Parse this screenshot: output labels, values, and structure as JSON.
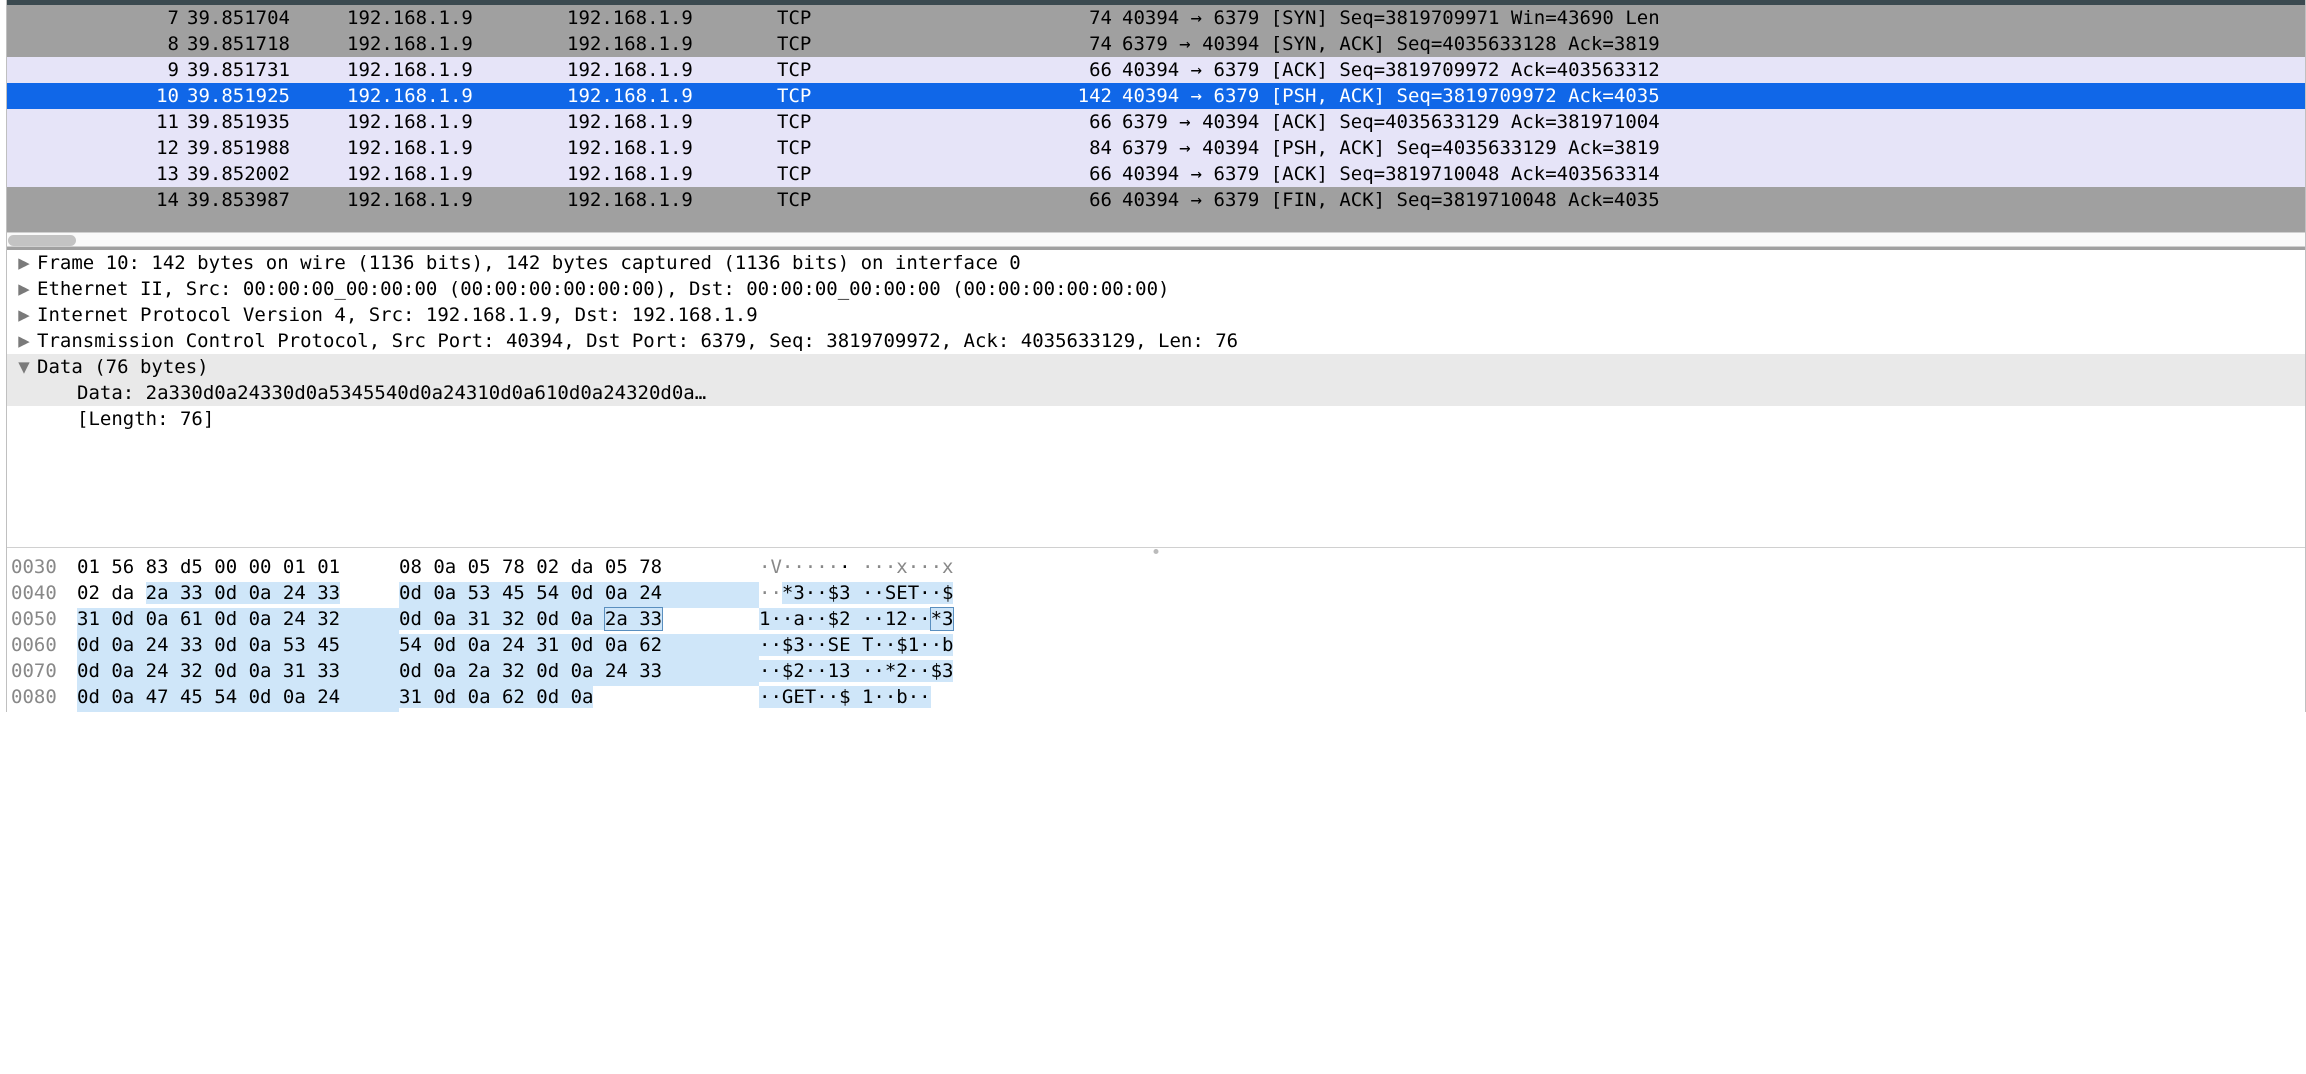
{
  "packets": [
    {
      "no": "7",
      "time": "39.851704",
      "src": "192.168.1.9",
      "dst": "192.168.1.9",
      "proto": "TCP",
      "len": "74",
      "info": "40394 → 6379 [SYN] Seq=3819709971 Win=43690 Len",
      "bg": "bg-gray"
    },
    {
      "no": "8",
      "time": "39.851718",
      "src": "192.168.1.9",
      "dst": "192.168.1.9",
      "proto": "TCP",
      "len": "74",
      "info": "6379 → 40394 [SYN, ACK] Seq=4035633128 Ack=3819",
      "bg": "bg-gray"
    },
    {
      "no": "9",
      "time": "39.851731",
      "src": "192.168.1.9",
      "dst": "192.168.1.9",
      "proto": "TCP",
      "len": "66",
      "info": "40394 → 6379 [ACK] Seq=3819709972 Ack=403563312",
      "bg": "bg-lav"
    },
    {
      "no": "10",
      "time": "39.851925",
      "src": "192.168.1.9",
      "dst": "192.168.1.9",
      "proto": "TCP",
      "len": "142",
      "info": "40394 → 6379 [PSH, ACK] Seq=3819709972 Ack=4035",
      "bg": "bg-sel"
    },
    {
      "no": "11",
      "time": "39.851935",
      "src": "192.168.1.9",
      "dst": "192.168.1.9",
      "proto": "TCP",
      "len": "66",
      "info": "6379 → 40394 [ACK] Seq=4035633129 Ack=381971004",
      "bg": "bg-lav"
    },
    {
      "no": "12",
      "time": "39.851988",
      "src": "192.168.1.9",
      "dst": "192.168.1.9",
      "proto": "TCP",
      "len": "84",
      "info": "6379 → 40394 [PSH, ACK] Seq=4035633129 Ack=3819",
      "bg": "bg-lav"
    },
    {
      "no": "13",
      "time": "39.852002",
      "src": "192.168.1.9",
      "dst": "192.168.1.9",
      "proto": "TCP",
      "len": "66",
      "info": "40394 → 6379 [ACK] Seq=3819710048 Ack=403563314",
      "bg": "bg-lav"
    },
    {
      "no": "14",
      "time": "39.853987",
      "src": "192.168.1.9",
      "dst": "192.168.1.9",
      "proto": "TCP",
      "len": "66",
      "info": "40394 → 6379 [FIN, ACK] Seq=3819710048 Ack=4035",
      "bg": "bg-gray"
    }
  ],
  "details": {
    "frame": "Frame 10: 142 bytes on wire (1136 bits), 142 bytes captured (1136 bits) on interface 0",
    "eth": "Ethernet II, Src: 00:00:00_00:00:00 (00:00:00:00:00:00), Dst: 00:00:00_00:00:00 (00:00:00:00:00:00)",
    "ip": "Internet Protocol Version 4, Src: 192.168.1.9, Dst: 192.168.1.9",
    "tcp": "Transmission Control Protocol, Src Port: 40394, Dst Port: 6379, Seq: 3819709972, Ack: 4035633129, Len: 76",
    "data_hdr": "Data (76 bytes)",
    "data_hex": "Data: 2a330d0a24330d0a5345540d0a24310d0a610d0a24320d0a…",
    "data_len": "[Length: 76]"
  },
  "hex": {
    "r0030": {
      "off": "0030",
      "c1": "01 56 83 d5 00 00 01 01",
      "c2": "08 0a 05 78 02 da 05 78",
      "a1a": "·V·····",
      "a1b": "·",
      "a2": " ···x···x"
    },
    "r0040": {
      "off": "0040",
      "c1a": "02 da ",
      "c1b": "2a 33 0d 0a 24 33",
      "c2": "0d 0a 53 45 54 0d 0a 24",
      "a1a": "··",
      "a1b": "*3··$3",
      "a2": " ··SET··$"
    },
    "r0050": {
      "off": "0050",
      "c1": "31 0d 0a 61 0d 0a 24 32",
      "c2a": "0d 0a 31 32 0d 0a ",
      "c2b": "2a 33",
      "a1": "1··a··$2",
      "a2a": " ··12··",
      "a2b": "*3"
    },
    "r0060": {
      "off": "0060",
      "c1": "0d 0a 24 33 0d 0a 53 45",
      "c2": "54 0d 0a 24 31 0d 0a 62",
      "a1": "··$3··SE",
      "a2": " T··$1··b"
    },
    "r0070": {
      "off": "0070",
      "c1": "0d 0a 24 32 0d 0a 31 33",
      "c2": "0d 0a 2a 32 0d 0a 24 33",
      "a1": "··$2··13",
      "a2": " ··*2··$3"
    },
    "r0080": {
      "off": "0080",
      "c1": "0d 0a 47 45 54 0d 0a 24",
      "c2": "31 0d 0a 62 0d 0a",
      "a1": "··GET··$",
      "a2": " 1··b··"
    }
  },
  "glyphs": {
    "tri_right": "▶",
    "tri_down": "▼"
  }
}
